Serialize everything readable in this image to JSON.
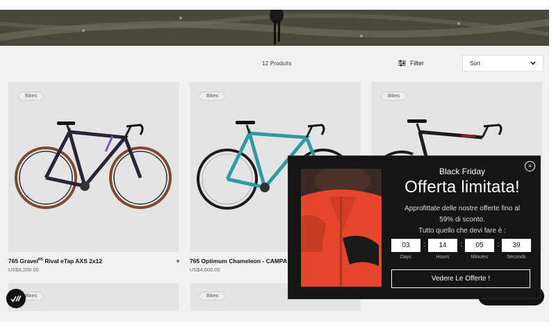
{
  "toolbar": {
    "product_count": "12 Produits",
    "filter_label": "Filter",
    "sort_label": "Sort"
  },
  "products": [
    {
      "badge": "Bikes",
      "name": "765 Gravel",
      "name_sup": "RS",
      "name_suffix": " Rival eTap AXS 2x12",
      "price": "US$6,200.00",
      "frame_color": "#2b2437",
      "accent_color": "#7a55a8"
    },
    {
      "badge": "Bikes",
      "name": "765 Optimum Chameleon - CAMPA",
      "price": "US$4,600.00",
      "frame_color": "#2f9aa0",
      "accent_color": "#1e6f74"
    },
    {
      "badge": "Bikes",
      "frame_color": "#1c1c1c",
      "accent_color": "#8b1f25"
    }
  ],
  "second_row": [
    {
      "badge": "Bikes"
    },
    {
      "badge": "Bikes"
    }
  ],
  "popup": {
    "pretitle": "Black Friday",
    "title": "Offerta limitata!",
    "description_line1": "Approfittate delle nostre offerte fino al",
    "description_line2": "59% di sconto.",
    "description_line3": "Tutto quello che devi fare è :",
    "countdown": [
      {
        "value": "03",
        "label": "Days"
      },
      {
        "value": "14",
        "label": "Hours"
      },
      {
        "value": "05",
        "label": "Minutes"
      },
      {
        "value": "39",
        "label": "Seconds"
      }
    ],
    "cta_label": "Vedere Le Offerte !",
    "close_glyph": "×"
  },
  "icons": {
    "filter": "sliders-icon",
    "sort_chevron": "chevron-down-icon",
    "close": "close-icon",
    "fab": "brand-logo-icon",
    "chat": "chat-icon"
  },
  "colors": {
    "popup_bg": "#151515",
    "card_bg": "#e4e4e4",
    "jersey": "#e8452d"
  }
}
